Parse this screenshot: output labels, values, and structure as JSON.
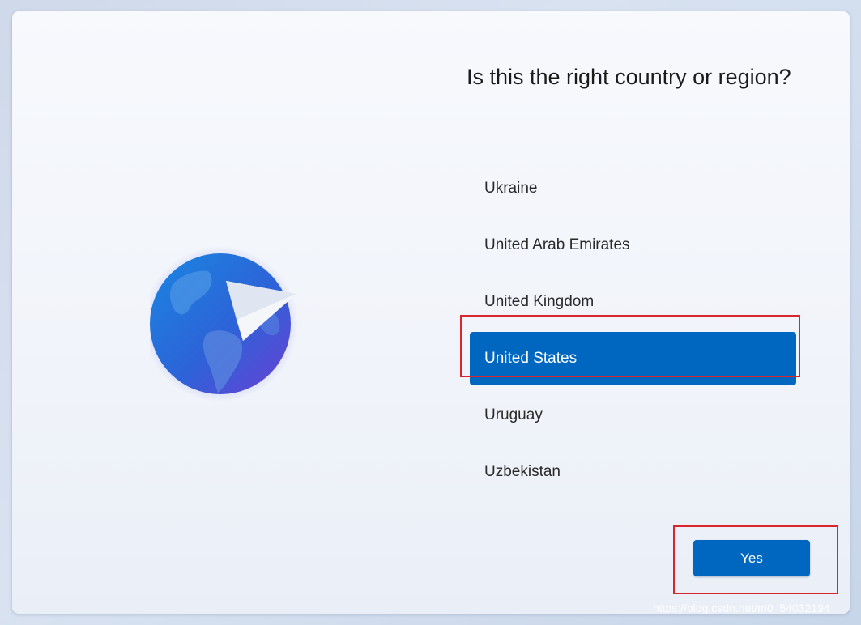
{
  "dialog": {
    "title": "Is this the right country or region?",
    "countries": [
      "Ukraine",
      "United Arab Emirates",
      "United Kingdom",
      "United States",
      "Uruguay",
      "Uzbekistan"
    ],
    "selected_country": "United States",
    "yes_label": "Yes"
  },
  "illustration": {
    "icon": "globe-paper-plane-icon"
  },
  "watermark": {
    "text": "https://blog.csdn.net/m0_54032194"
  },
  "colors": {
    "accent": "#0067c0",
    "highlight_box": "#d9262c",
    "text": "#1b1b1b"
  }
}
